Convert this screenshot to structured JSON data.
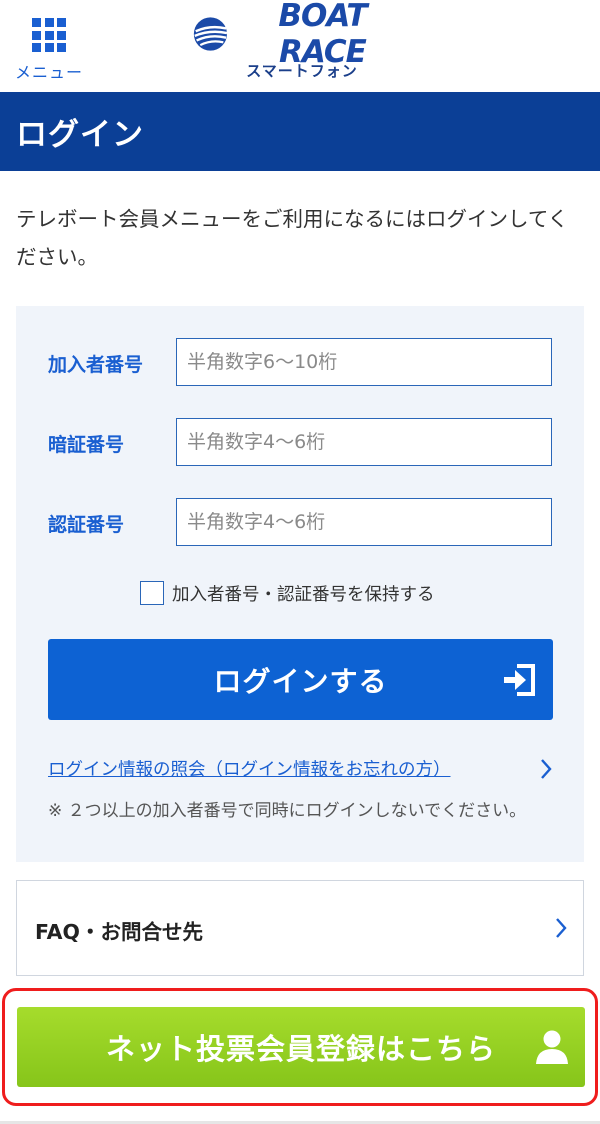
{
  "header": {
    "menu_label": "メニュー",
    "logo_text": "BOAT RACE",
    "logo_sub": "スマートフォン"
  },
  "title": "ログイン",
  "intro": "テレボート会員メニューをご利用になるにはログインしてください。",
  "form": {
    "fields": [
      {
        "label": "加入者番号",
        "placeholder": "半角数字6～10桁",
        "value": ""
      },
      {
        "label": "暗証番号",
        "placeholder": "半角数字4～6桁",
        "value": ""
      },
      {
        "label": "認証番号",
        "placeholder": "半角数字4～6桁",
        "value": ""
      }
    ],
    "keep_label": "加入者番号・認証番号を保持する",
    "keep_checked": false,
    "login_button": "ログインする",
    "forgot_link": "ログイン情報の照会（ログイン情報をお忘れの方）",
    "note": "※ ２つ以上の加入者番号で同時にログインしないでください。"
  },
  "faq": {
    "label": "FAQ・お問合せ先"
  },
  "register": {
    "label": "ネット投票会員登録はこちら"
  },
  "colors": {
    "brand_blue": "#0b3f96",
    "button_blue": "#0d62d3",
    "link_blue": "#1a5fd1",
    "register_green": "#8cc820",
    "highlight_red": "#ef1d1d"
  },
  "icons": [
    "grid-menu-icon",
    "boat-race-logo-icon",
    "login-arrow-icon",
    "chevron-right-icon",
    "user-icon"
  ]
}
